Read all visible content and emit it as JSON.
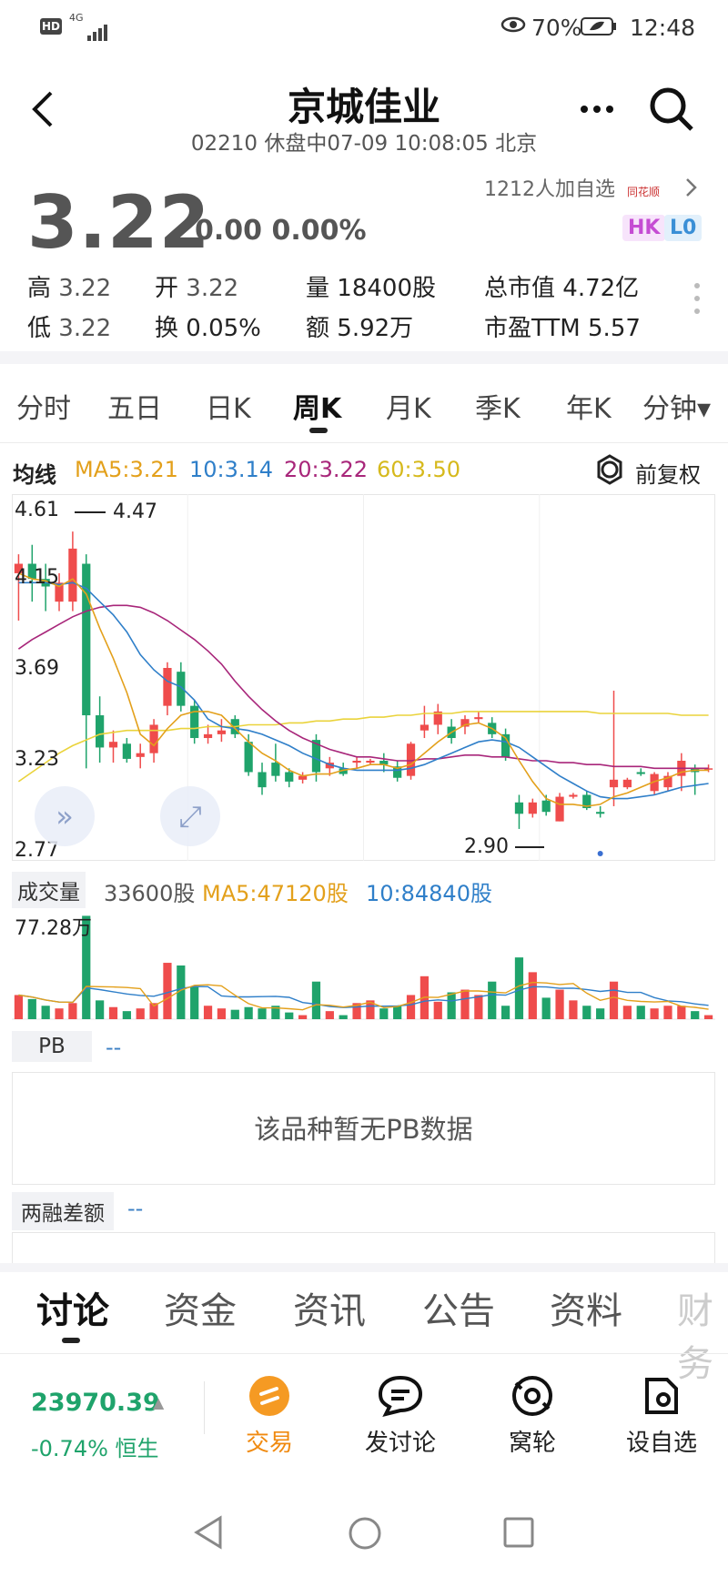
{
  "status_bar": {
    "hd": "HD",
    "signal": "4G",
    "battery": "70%",
    "time": "12:48"
  },
  "header": {
    "title": "京城佳业",
    "subtitle": "02210 休盘中07-09 10:08:05 北京"
  },
  "quote": {
    "price": "3.22",
    "change": "0.00 0.00%",
    "watchers": "1212人加自选",
    "source_logo": "同花顺",
    "tag_hk": "HK",
    "tag_l0": "L0",
    "stats": [
      {
        "label": "高",
        "value": "3.22"
      },
      {
        "label": "开",
        "value": "3.22"
      },
      {
        "label": "量",
        "value": "18400股"
      },
      {
        "label": "总市值",
        "value": "4.72亿"
      },
      {
        "label": "低",
        "value": "3.22"
      },
      {
        "label": "换",
        "value": "0.05%"
      },
      {
        "label": "额",
        "value": "5.92万"
      },
      {
        "label": "市盈TTM",
        "value": "5.57"
      }
    ]
  },
  "period_tabs": [
    "分时",
    "五日",
    "日K",
    "周K",
    "月K",
    "季K",
    "年K",
    "分钟▾"
  ],
  "active_period": "周K",
  "ma_legend": {
    "title": "均线",
    "ma5": "MA5:3.21",
    "ma10": "10:3.14",
    "ma20": "20:3.22",
    "ma60": "60:3.50",
    "adjust": "前复权"
  },
  "chart_axis": {
    "y1": "4.61",
    "y2": "4.15",
    "y3": "3.69",
    "y4": "3.23",
    "y5": "2.77",
    "high_mark": "4.47",
    "low_mark": "2.90"
  },
  "volume": {
    "title": "成交量",
    "current": "33600股",
    "ma5": "MA5:47120股",
    "ma10": "10:84840股",
    "max_label": "77.28万"
  },
  "pb": {
    "title": "PB",
    "value": "--",
    "empty_text": "该品种暂无PB数据"
  },
  "margin": {
    "title": "两融差额",
    "value": "--"
  },
  "bottom_tabs": [
    "讨论",
    "资金",
    "资讯",
    "公告",
    "资料",
    "财务"
  ],
  "bottom_bar": {
    "index_value": "23970.39",
    "index_change": "-0.74% 恒生",
    "trade": "交易",
    "post": "发讨论",
    "wolun": "窝轮",
    "watchlist": "设自选"
  },
  "colors": {
    "up": "#ef4c4c",
    "down": "#1fa36b",
    "ma5": "#e3a01b",
    "ma10": "#2f7fc9",
    "ma20": "#a8267a",
    "ma60": "#ead33b"
  },
  "chart_data": {
    "type": "candlestick",
    "ylim": [
      2.77,
      4.61
    ],
    "candles": [
      {
        "o": 4.25,
        "h": 4.35,
        "l": 4.0,
        "c": 4.3
      },
      {
        "o": 4.3,
        "h": 4.4,
        "l": 4.1,
        "c": 4.22
      },
      {
        "o": 4.22,
        "h": 4.3,
        "l": 4.05,
        "c": 4.18
      },
      {
        "o": 4.1,
        "h": 4.25,
        "l": 4.05,
        "c": 4.2
      },
      {
        "o": 4.1,
        "h": 4.47,
        "l": 4.05,
        "c": 4.38
      },
      {
        "o": 4.3,
        "h": 4.35,
        "l": 3.22,
        "c": 3.5
      },
      {
        "o": 3.5,
        "h": 3.6,
        "l": 3.25,
        "c": 3.33
      },
      {
        "o": 3.33,
        "h": 3.42,
        "l": 3.25,
        "c": 3.36
      },
      {
        "o": 3.35,
        "h": 3.38,
        "l": 3.25,
        "c": 3.27
      },
      {
        "o": 3.28,
        "h": 3.35,
        "l": 3.22,
        "c": 3.3
      },
      {
        "o": 3.3,
        "h": 3.48,
        "l": 3.25,
        "c": 3.45
      },
      {
        "o": 3.55,
        "h": 3.78,
        "l": 3.5,
        "c": 3.75
      },
      {
        "o": 3.73,
        "h": 3.78,
        "l": 3.52,
        "c": 3.55
      },
      {
        "o": 3.55,
        "h": 3.58,
        "l": 3.35,
        "c": 3.38
      },
      {
        "o": 3.38,
        "h": 3.45,
        "l": 3.35,
        "c": 3.4
      },
      {
        "o": 3.4,
        "h": 3.48,
        "l": 3.36,
        "c": 3.42
      },
      {
        "o": 3.48,
        "h": 3.5,
        "l": 3.38,
        "c": 3.4
      },
      {
        "o": 3.36,
        "h": 3.4,
        "l": 3.18,
        "c": 3.2
      },
      {
        "o": 3.2,
        "h": 3.25,
        "l": 3.08,
        "c": 3.12
      },
      {
        "o": 3.25,
        "h": 3.35,
        "l": 3.15,
        "c": 3.18
      },
      {
        "o": 3.2,
        "h": 3.22,
        "l": 3.12,
        "c": 3.15
      },
      {
        "o": 3.16,
        "h": 3.2,
        "l": 3.14,
        "c": 3.18
      },
      {
        "o": 3.37,
        "h": 3.4,
        "l": 3.15,
        "c": 3.2
      },
      {
        "o": 3.22,
        "h": 3.28,
        "l": 3.18,
        "c": 3.25
      },
      {
        "o": 3.22,
        "h": 3.25,
        "l": 3.18,
        "c": 3.19
      },
      {
        "o": 3.25,
        "h": 3.28,
        "l": 3.22,
        "c": 3.26
      },
      {
        "o": 3.25,
        "h": 3.27,
        "l": 3.24,
        "c": 3.26
      },
      {
        "o": 3.26,
        "h": 3.3,
        "l": 3.2,
        "c": 3.24
      },
      {
        "o": 3.23,
        "h": 3.26,
        "l": 3.15,
        "c": 3.17
      },
      {
        "o": 3.18,
        "h": 3.36,
        "l": 3.16,
        "c": 3.35
      },
      {
        "o": 3.42,
        "h": 3.55,
        "l": 3.38,
        "c": 3.45
      },
      {
        "o": 3.45,
        "h": 3.56,
        "l": 3.4,
        "c": 3.52
      },
      {
        "o": 3.44,
        "h": 3.48,
        "l": 3.35,
        "c": 3.38
      },
      {
        "o": 3.44,
        "h": 3.5,
        "l": 3.4,
        "c": 3.48
      },
      {
        "o": 3.48,
        "h": 3.52,
        "l": 3.46,
        "c": 3.49
      },
      {
        "o": 3.46,
        "h": 3.49,
        "l": 3.38,
        "c": 3.4
      },
      {
        "o": 3.4,
        "h": 3.43,
        "l": 3.26,
        "c": 3.28
      },
      {
        "o": 3.04,
        "h": 3.08,
        "l": 2.9,
        "c": 2.98
      },
      {
        "o": 2.98,
        "h": 3.06,
        "l": 2.96,
        "c": 3.04
      },
      {
        "o": 3.05,
        "h": 3.08,
        "l": 2.97,
        "c": 2.99
      },
      {
        "o": 2.94,
        "h": 3.09,
        "l": 2.94,
        "c": 3.07
      },
      {
        "o": 3.07,
        "h": 3.09,
        "l": 3.06,
        "c": 3.08
      },
      {
        "o": 3.08,
        "h": 3.1,
        "l": 3.0,
        "c": 3.01
      },
      {
        "o": 2.99,
        "h": 3.02,
        "l": 2.96,
        "c": 2.98
      },
      {
        "o": 3.12,
        "h": 3.63,
        "l": 3.02,
        "c": 3.16
      },
      {
        "o": 3.12,
        "h": 3.17,
        "l": 3.11,
        "c": 3.16
      },
      {
        "o": 3.2,
        "h": 3.22,
        "l": 3.18,
        "c": 3.19
      },
      {
        "o": 3.1,
        "h": 3.2,
        "l": 3.08,
        "c": 3.19
      },
      {
        "o": 3.12,
        "h": 3.2,
        "l": 3.1,
        "c": 3.18
      },
      {
        "o": 3.18,
        "h": 3.3,
        "l": 3.1,
        "c": 3.26
      },
      {
        "o": 3.22,
        "h": 3.24,
        "l": 3.08,
        "c": 3.2
      },
      {
        "o": 3.22,
        "h": 3.24,
        "l": 3.2,
        "c": 3.22
      }
    ],
    "ma5": [
      4.25,
      4.22,
      4.21,
      4.18,
      4.22,
      4.14,
      3.96,
      3.8,
      3.62,
      3.4,
      3.34,
      3.43,
      3.5,
      3.52,
      3.52,
      3.5,
      3.43,
      3.36,
      3.3,
      3.26,
      3.21,
      3.18,
      3.19,
      3.19,
      3.21,
      3.22,
      3.24,
      3.24,
      3.22,
      3.24,
      3.3,
      3.36,
      3.41,
      3.45,
      3.46,
      3.43,
      3.38,
      3.26,
      3.15,
      3.06,
      3.03,
      3.03,
      3.02,
      3.03,
      3.07,
      3.09,
      3.12,
      3.15,
      3.17,
      3.2,
      3.21,
      3.21
    ],
    "ma10": [
      4.2,
      4.2,
      4.2,
      4.19,
      4.2,
      4.17,
      4.1,
      4.03,
      3.94,
      3.82,
      3.74,
      3.68,
      3.65,
      3.58,
      3.48,
      3.44,
      3.43,
      3.42,
      3.4,
      3.37,
      3.34,
      3.3,
      3.27,
      3.24,
      3.22,
      3.21,
      3.21,
      3.21,
      3.21,
      3.22,
      3.24,
      3.27,
      3.3,
      3.33,
      3.36,
      3.37,
      3.36,
      3.33,
      3.28,
      3.23,
      3.18,
      3.14,
      3.1,
      3.07,
      3.06,
      3.06,
      3.07,
      3.08,
      3.1,
      3.12,
      3.13,
      3.14
    ],
    "ma20": [
      3.85,
      3.9,
      3.94,
      3.98,
      4.02,
      4.05,
      4.07,
      4.08,
      4.08,
      4.07,
      4.04,
      4.0,
      3.95,
      3.9,
      3.84,
      3.77,
      3.68,
      3.6,
      3.53,
      3.47,
      3.42,
      3.38,
      3.35,
      3.32,
      3.3,
      3.28,
      3.28,
      3.27,
      3.26,
      3.26,
      3.27,
      3.27,
      3.28,
      3.29,
      3.29,
      3.28,
      3.28,
      3.27,
      3.26,
      3.26,
      3.25,
      3.25,
      3.24,
      3.24,
      3.23,
      3.23,
      3.23,
      3.22,
      3.22,
      3.22,
      3.22,
      3.22
    ],
    "ma60": [
      3.15,
      3.2,
      3.25,
      3.3,
      3.34,
      3.37,
      3.4,
      3.41,
      3.42,
      3.42,
      3.42,
      3.42,
      3.43,
      3.43,
      3.44,
      3.44,
      3.44,
      3.45,
      3.45,
      3.45,
      3.46,
      3.46,
      3.47,
      3.47,
      3.48,
      3.48,
      3.49,
      3.49,
      3.5,
      3.5,
      3.51,
      3.51,
      3.51,
      3.52,
      3.52,
      3.52,
      3.52,
      3.52,
      3.52,
      3.52,
      3.52,
      3.52,
      3.52,
      3.51,
      3.51,
      3.51,
      3.51,
      3.51,
      3.51,
      3.5,
      3.5,
      3.5
    ],
    "volumes": [
      18,
      15,
      10,
      8,
      12,
      77,
      14,
      9,
      6,
      8,
      12,
      42,
      40,
      24,
      10,
      8,
      7,
      9,
      8,
      10,
      5,
      3,
      28,
      6,
      3,
      12,
      14,
      8,
      10,
      18,
      32,
      13,
      20,
      22,
      18,
      28,
      10,
      46,
      35,
      16,
      22,
      14,
      10,
      8,
      28,
      10,
      10,
      8,
      10,
      10,
      6,
      3
    ]
  }
}
